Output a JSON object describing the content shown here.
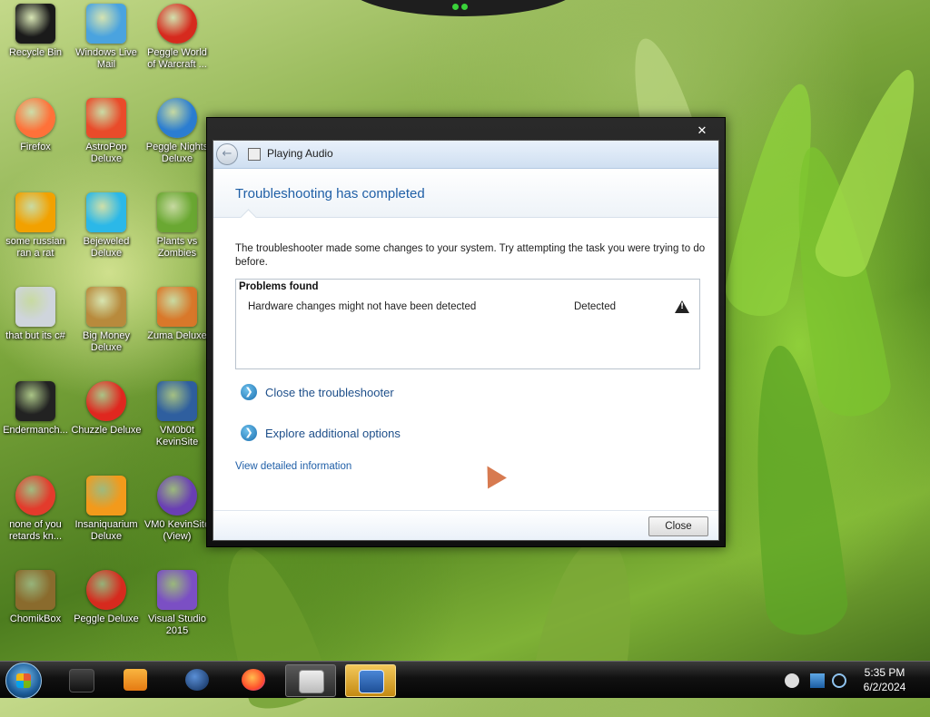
{
  "desktop": {
    "icons": [
      {
        "label": "Recycle Bin",
        "icon": "recycle-bin-icon",
        "color": "#1a1a1a"
      },
      {
        "label": "Windows Live Mail",
        "icon": "mail-icon",
        "color": "#4aa3df"
      },
      {
        "label": "Peggle World of Warcraft ...",
        "icon": "peggle-icon",
        "color": "#d62a1e"
      },
      {
        "label": "Firefox",
        "icon": "firefox-icon",
        "color": "#ff7139"
      },
      {
        "label": "AstroPop Deluxe",
        "icon": "astropop-icon",
        "color": "#e94b2a"
      },
      {
        "label": "Peggle Nights Deluxe",
        "icon": "peggle-icon",
        "color": "#2b7dd1"
      },
      {
        "label": "some russian ran a rat",
        "icon": "app-de-icon",
        "color": "#f2a100"
      },
      {
        "label": "Bejeweled Deluxe",
        "icon": "gem-icon",
        "color": "#2bb8e8"
      },
      {
        "label": "Plants vs Zombies",
        "icon": "plants-icon",
        "color": "#6aa832"
      },
      {
        "label": "that but its c#",
        "icon": "windows-stack-icon",
        "color": "#cfd5dc"
      },
      {
        "label": "Big Money Deluxe",
        "icon": "money-bag-icon",
        "color": "#b88a3c"
      },
      {
        "label": "Zuma Deluxe",
        "icon": "zuma-icon",
        "color": "#d9782a"
      },
      {
        "label": "Endermanch...",
        "icon": "console-icon",
        "color": "#222222"
      },
      {
        "label": "Chuzzle Deluxe",
        "icon": "chuzzle-icon",
        "color": "#e0271f"
      },
      {
        "label": "VM0b0t KevinSite",
        "icon": "vm-icon",
        "color": "#2f5f9f"
      },
      {
        "label": "none of you retards kn...",
        "icon": "dino-icon",
        "color": "#e33b2c"
      },
      {
        "label": "Insaniquarium Deluxe",
        "icon": "fish-icon",
        "color": "#f39a1b"
      },
      {
        "label": "VM0 KevinSite (View)",
        "icon": "firefox-file-icon",
        "color": "#6a3fb4"
      },
      {
        "label": "ChomikBox",
        "icon": "hamster-icon",
        "color": "#8a6b2d"
      },
      {
        "label": "Peggle Deluxe",
        "icon": "peggle-icon",
        "color": "#d62a1e"
      },
      {
        "label": "Visual Studio 2015",
        "icon": "visual-studio-icon",
        "color": "#7b4fc4"
      }
    ]
  },
  "dialog": {
    "close_glyph": "✕",
    "back_glyph": "←",
    "header_title": "Playing Audio",
    "banner_title": "Troubleshooting has completed",
    "description": "The troubleshooter made some changes to your system. Try attempting the task you were trying to do before.",
    "problems_heading": "Problems found",
    "problem": {
      "name": "Hardware changes might not have been detected",
      "status": "Detected"
    },
    "actions": [
      {
        "label": "Close the troubleshooter",
        "glyph": "❯"
      },
      {
        "label": "Explore additional options",
        "glyph": "❯"
      }
    ],
    "detail_link": "View detailed information",
    "close_button": "Close"
  },
  "taskbar": {
    "pinned": [
      "media-player-icon",
      "windows-media-icon",
      "earth-icon",
      "firefox-icon",
      "notepad-icon",
      "troubleshooter-icon"
    ],
    "tray": [
      "show-hidden-icons-icon",
      "monitor-icon",
      "network-icon"
    ],
    "time": "5:35 PM",
    "date": "6/2/2024"
  }
}
